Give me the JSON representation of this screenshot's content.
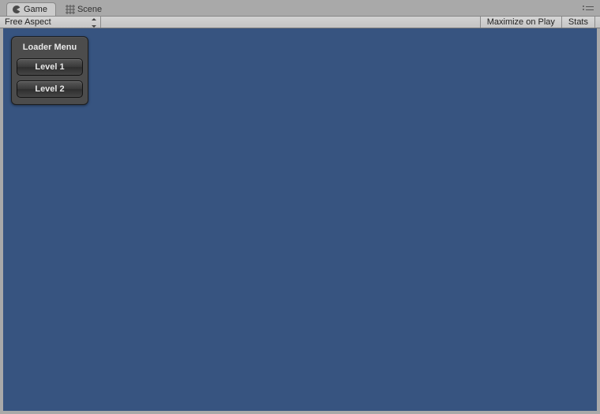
{
  "tabs": {
    "game": "Game",
    "scene": "Scene"
  },
  "toolbar": {
    "aspect": "Free Aspect",
    "maximize": "Maximize on Play",
    "stats": "Stats"
  },
  "loader": {
    "title": "Loader Menu",
    "buttons": [
      "Level 1",
      "Level 2"
    ]
  },
  "colors": {
    "viewport_bg": "#375480"
  }
}
